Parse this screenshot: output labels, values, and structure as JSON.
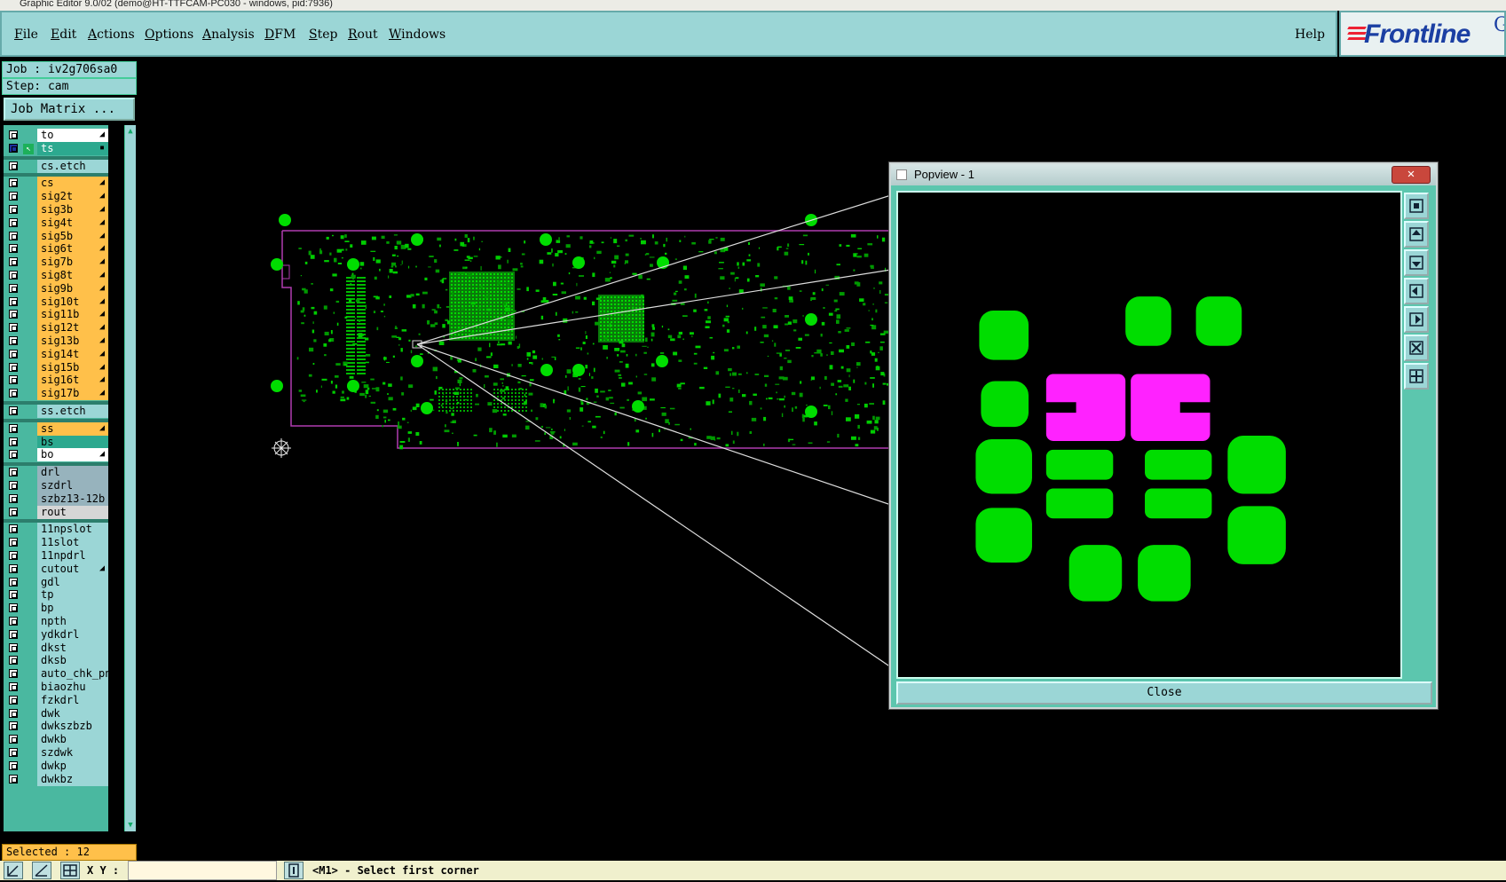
{
  "window_title": "Graphic Editor 9.0/02 (demo@HT-TTFCAM-PC030 - windows, pid:7936)",
  "menu": {
    "items": [
      {
        "label": "File",
        "u": "F",
        "rest": "ile"
      },
      {
        "label": "Edit",
        "u": "E",
        "rest": "dit"
      },
      {
        "label": "Actions",
        "u": "A",
        "rest": "ctions"
      },
      {
        "label": "Options",
        "u": "O",
        "rest": "ptions"
      },
      {
        "label": "Analysis",
        "u": "A",
        "rest": "nalysis"
      },
      {
        "label": "DFM",
        "u": "D",
        "rest": "FM"
      },
      {
        "label": "Step",
        "u": "S",
        "rest": "tep"
      },
      {
        "label": "Rout",
        "u": "R",
        "rest": "out"
      },
      {
        "label": "Windows",
        "u": "W",
        "rest": "indows"
      }
    ],
    "help": "Help"
  },
  "logo": {
    "brand": "Frontline",
    "suffix": "G",
    "accent": "#e22233",
    "color": "#1b3fa3"
  },
  "job": {
    "job_line": "Job : iv2g706sa0",
    "step_line": "Step: cam",
    "matrix_button": "Job Matrix ..."
  },
  "layers": [
    {
      "name": "to",
      "color": "#ffffff",
      "mark": "◢"
    },
    {
      "name": "ts",
      "color": "#2ca98f",
      "mark": "▪",
      "active": true
    },
    {
      "sep": true
    },
    {
      "name": "cs.etch",
      "color": "#9bd6d6"
    },
    {
      "sep": true
    },
    {
      "name": "cs",
      "color": "#ffc04a",
      "mark": "◢"
    },
    {
      "name": "sig2t",
      "color": "#ffc04a",
      "mark": "◢"
    },
    {
      "name": "sig3b",
      "color": "#ffc04a",
      "mark": "◢"
    },
    {
      "name": "sig4t",
      "color": "#ffc04a",
      "mark": "◢"
    },
    {
      "name": "sig5b",
      "color": "#ffc04a",
      "mark": "◢"
    },
    {
      "name": "sig6t",
      "color": "#ffc04a",
      "mark": "◢"
    },
    {
      "name": "sig7b",
      "color": "#ffc04a",
      "mark": "◢"
    },
    {
      "name": "sig8t",
      "color": "#ffc04a",
      "mark": "◢"
    },
    {
      "name": "sig9b",
      "color": "#ffc04a",
      "mark": "◢"
    },
    {
      "name": "sig10t",
      "color": "#ffc04a",
      "mark": "◢"
    },
    {
      "name": "sig11b",
      "color": "#ffc04a",
      "mark": "◢"
    },
    {
      "name": "sig12t",
      "color": "#ffc04a",
      "mark": "◢"
    },
    {
      "name": "sig13b",
      "color": "#ffc04a",
      "mark": "◢"
    },
    {
      "name": "sig14t",
      "color": "#ffc04a",
      "mark": "◢"
    },
    {
      "name": "sig15b",
      "color": "#ffc04a",
      "mark": "◢"
    },
    {
      "name": "sig16t",
      "color": "#ffc04a",
      "mark": "◢"
    },
    {
      "name": "sig17b",
      "color": "#ffc04a",
      "mark": "◢"
    },
    {
      "sep": true
    },
    {
      "name": "ss.etch",
      "color": "#9bd6d6"
    },
    {
      "sep": true
    },
    {
      "name": "ss",
      "color": "#ffc04a",
      "mark": "◢"
    },
    {
      "name": "bs",
      "color": "#2ca98f"
    },
    {
      "name": "bo",
      "color": "#ffffff",
      "mark": "◢"
    },
    {
      "sep": true
    },
    {
      "name": "drl",
      "color": "#97b3bd"
    },
    {
      "name": "szdrl",
      "color": "#97b3bd"
    },
    {
      "name": "szbz13-12b",
      "color": "#97b3bd"
    },
    {
      "name": "rout",
      "color": "#d6d6d6"
    },
    {
      "sep": true
    },
    {
      "name": "11npslot",
      "color": "#9bd6d6"
    },
    {
      "name": "11slot",
      "color": "#9bd6d6"
    },
    {
      "name": "11npdrl",
      "color": "#9bd6d6"
    },
    {
      "name": "cutout",
      "color": "#9bd6d6",
      "mark": "◢"
    },
    {
      "name": "gdl",
      "color": "#9bd6d6"
    },
    {
      "name": "tp",
      "color": "#9bd6d6"
    },
    {
      "name": "bp",
      "color": "#9bd6d6"
    },
    {
      "name": "npth",
      "color": "#9bd6d6"
    },
    {
      "name": "ydkdrl",
      "color": "#9bd6d6"
    },
    {
      "name": "dkst",
      "color": "#9bd6d6"
    },
    {
      "name": "dksb",
      "color": "#9bd6d6"
    },
    {
      "name": "auto_chk_pnl",
      "color": "#9bd6d6"
    },
    {
      "name": "biaozhu",
      "color": "#9bd6d6"
    },
    {
      "name": "fzkdrl",
      "color": "#9bd6d6"
    },
    {
      "name": "dwk",
      "color": "#9bd6d6"
    },
    {
      "name": "dwkszbzb",
      "color": "#9bd6d6"
    },
    {
      "name": "dwkb",
      "color": "#9bd6d6"
    },
    {
      "name": "szdwk",
      "color": "#9bd6d6"
    },
    {
      "name": "dwkp",
      "color": "#9bd6d6"
    },
    {
      "name": "dwkbz",
      "color": "#9bd6d6"
    }
  ],
  "selected": "Selected : 12",
  "bottom": {
    "xy_label": "X Y :",
    "xy_value": "",
    "status": "<M1> - Select first corner"
  },
  "popview": {
    "title": "Popview - 1",
    "close_x": "✕",
    "close_button": "Close"
  },
  "colors": {
    "pad_green": "#00dd00",
    "pad_magenta": "#ff22ff",
    "profile": "#b03cb0",
    "panel_teal": "#9bd6d6"
  }
}
